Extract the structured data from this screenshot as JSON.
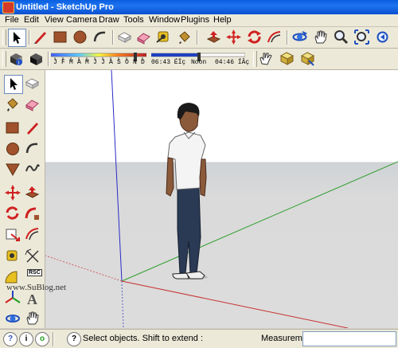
{
  "window": {
    "title": "Untitled - SketchUp Pro"
  },
  "menu": {
    "items": [
      "File",
      "Edit",
      "View",
      "Camera",
      "Draw",
      "Tools",
      "Window",
      "Plugins",
      "Help"
    ]
  },
  "shadow": {
    "months": [
      "J",
      "F",
      "M",
      "A",
      "M",
      "J",
      "J",
      "A",
      "S",
      "O",
      "N",
      "D"
    ],
    "time_start": "06:43 ÉÏç",
    "noon": "Noon",
    "time_end": "04:46 ÍÂç"
  },
  "status": {
    "hint": "Select objects. Shift to extend :",
    "measurements_label": "Measurements",
    "measurements_value": ""
  },
  "watermark": "www.SuBlog.net",
  "left_toolbar": {
    "rsc_label": "RSC"
  },
  "colors": {
    "axis_red": "#c83232",
    "axis_green": "#2e9e2e",
    "axis_blue": "#3030c8",
    "sky": "#ffffff",
    "ground": "#d9d9d9"
  }
}
